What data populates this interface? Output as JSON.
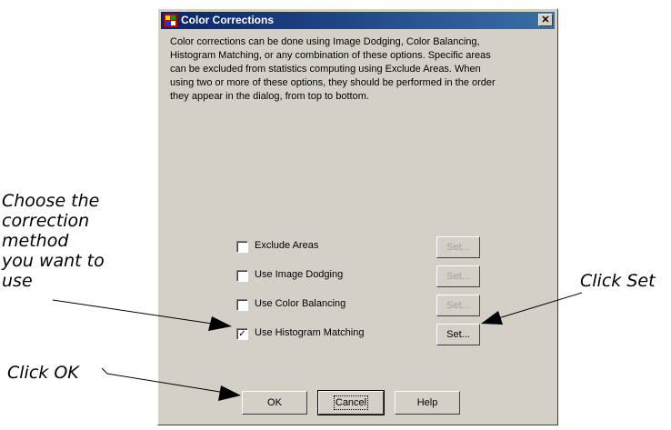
{
  "window": {
    "title": "Color Corrections",
    "close_glyph": "✕"
  },
  "description": "Color corrections can be done using Image Dodging, Color Balancing, Histogram Matching, or any combination of these options. Specific areas can be excluded from statistics computing using Exclude Areas. When using two or more of these options, they should be performed in the order they appear in the dialog, from top to bottom.",
  "options": [
    {
      "label": "Exclude Areas",
      "checked": false,
      "set_label": "Set...",
      "set_enabled": false
    },
    {
      "label": "Use Image Dodging",
      "checked": false,
      "set_label": "Set...",
      "set_enabled": false
    },
    {
      "label": "Use Color Balancing",
      "checked": false,
      "set_label": "Set...",
      "set_enabled": false
    },
    {
      "label": "Use Histogram Matching",
      "checked": true,
      "set_label": "Set...",
      "set_enabled": true
    }
  ],
  "buttons": {
    "ok": "OK",
    "cancel": "Cancel",
    "help": "Help"
  },
  "annotations": {
    "choose": [
      "Choose the",
      "correction",
      "method",
      "you want to",
      "use"
    ],
    "click_set": "Click Set",
    "click_ok": "Click OK"
  },
  "colors": {
    "dialog_bg": "#d4d0c8",
    "titlebar": "#0a246a",
    "disabled_text": "#a0a0a0"
  },
  "icons": [
    "app-icon",
    "close-icon",
    "checkbox-check-icon",
    "arrow-icon"
  ]
}
